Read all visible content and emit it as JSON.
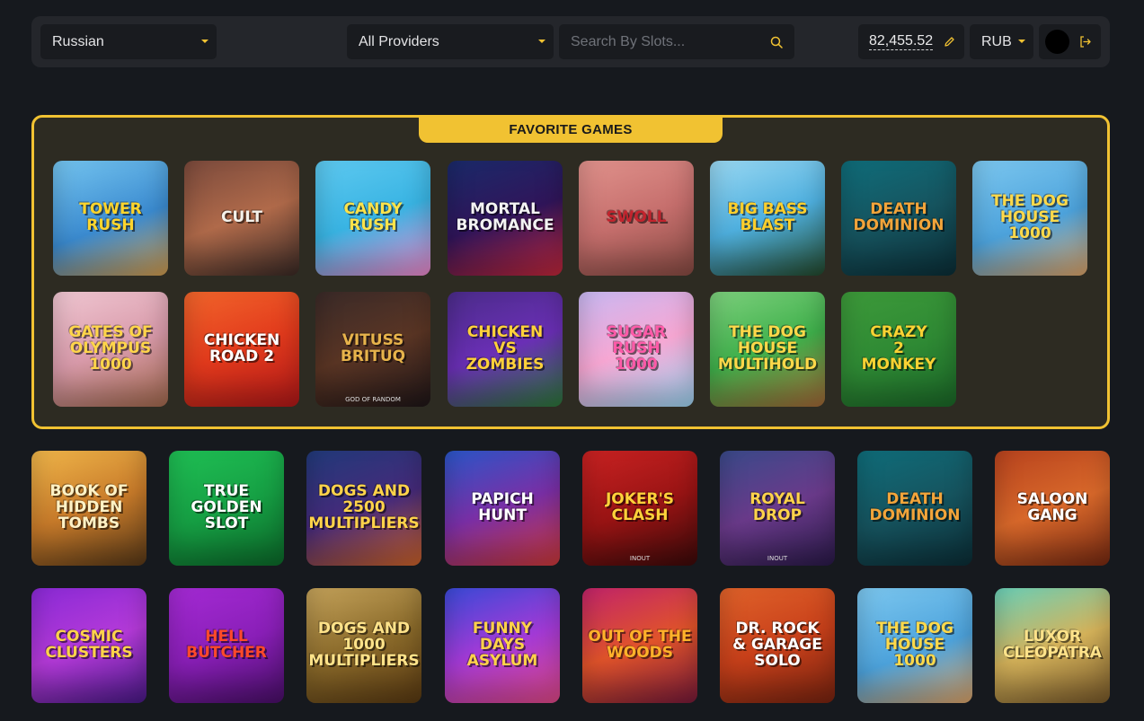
{
  "header": {
    "language": "Russian",
    "provider": "All Providers",
    "search_placeholder": "Search By Slots...",
    "balance": "82,455.52",
    "currency": "RUB"
  },
  "favorites": {
    "title": "FAVORITE GAMES",
    "games": [
      {
        "name": "TOWER\nRUSH",
        "bg": "linear-gradient(160deg,#74c4ef,#3b8bd0 55%,#d8a04e)",
        "color": "#ffd52c"
      },
      {
        "name": "CULT",
        "bg": "linear-gradient(160deg,#7b4a3c,#b06a4a 50%,#3a2a26)",
        "color": "#f4f1ea"
      },
      {
        "name": "CANDY\nRUSH",
        "bg": "linear-gradient(160deg,#5ec9f0,#39b4e3 50%,#f58bd0)",
        "color": "#ffe34a"
      },
      {
        "name": "MORTAL\nBROMANCE",
        "bg": "linear-gradient(160deg,#1a2a6a,#30155a 50%,#c7283c)",
        "color": "#f3f3f3"
      },
      {
        "name": "SWOLL",
        "bg": "linear-gradient(160deg,#e0928c,#c66f6d 50%,#8a4c44)",
        "color": "#c3232d"
      },
      {
        "name": "BIG BASS\nBLAST",
        "bg": "linear-gradient(160deg,#9ad8f2,#4fb0df 50%,#234a2c)",
        "color": "#ffcf2b"
      },
      {
        "name": "DEATH\nDOMINION",
        "bg": "linear-gradient(160deg,#0f6d7a,#16545f 50%,#0b2f38)",
        "color": "#f2a43a"
      },
      {
        "name": "THE DOG HOUSE\n1000",
        "bg": "linear-gradient(160deg,#7cc7ef,#4da3dc 55%,#e3a86a)",
        "color": "#ffd94a"
      },
      {
        "name": "GATES OF\nOLYMPUS\n1000",
        "bg": "linear-gradient(160deg,#f0c7d2,#d99bab 50%,#a66b4f)",
        "color": "#ffd54a"
      },
      {
        "name": "CHICKEN\nROAD 2",
        "bg": "linear-gradient(160deg,#f1652b,#e23a1c 50%,#b51919)",
        "color": "#ffffff"
      },
      {
        "name": "VITUSS BRITUQ",
        "sub": "GOD of RANDOM",
        "bg": "linear-gradient(160deg,#3a2a28,#5a3524 50%,#1f1618)",
        "color": "#e7b34b"
      },
      {
        "name": "CHICKEN\nVS\nZOMBIES",
        "bg": "linear-gradient(160deg,#4b2c8a,#6a2fb5 50%,#2d7a3a)",
        "color": "#ffd13a"
      },
      {
        "name": "SUGAR\nRUSH\n1000",
        "bg": "linear-gradient(160deg,#c8b8f2,#f7a7d3 50%,#9fd9f7)",
        "color": "#ff5aa8"
      },
      {
        "name": "THE DOG\nHOUSE MULTIHOLD",
        "bg": "linear-gradient(160deg,#7dd07d,#3fb04b 50%,#a76a38)",
        "color": "#ffd84a"
      },
      {
        "name": "CRAZY\n2\nMONKEY",
        "bg": "linear-gradient(160deg,#3d9a3a,#2f8a34 50%,#1c6a29)",
        "color": "#f9d233"
      }
    ]
  },
  "games": [
    {
      "name": "BOOK OF\nHIDDEN TOMBS",
      "bg": "linear-gradient(160deg,#f0b64a,#c87b2a 50%,#5a3a18)",
      "color": "#fff2c6"
    },
    {
      "name": "TRUE\nGOLDEN\nSLOT",
      "bg": "linear-gradient(160deg,#1fbf54,#16a044 50%,#0c6c2b)",
      "color": "#ffffff"
    },
    {
      "name": "DOGS AND 2500\nMULTIPLIERS",
      "bg": "linear-gradient(160deg,#213a7a,#452a7a 50%,#d0642a)",
      "color": "#ffd34a"
    },
    {
      "name": "PAPICH\nHUNT",
      "bg": "linear-gradient(160deg,#2a56c8,#7a2fa6 50%,#d23a3a)",
      "color": "#ffffff"
    },
    {
      "name": "JOKER'S\nCLASH",
      "sub": "INOUT",
      "bg": "linear-gradient(160deg,#c92222,#9a1414 50%,#3c0a0a)",
      "color": "#ffd23a"
    },
    {
      "name": "ROYAL\nDROP",
      "sub": "INOUT",
      "bg": "linear-gradient(160deg,#3a4a8a,#6a3a8a 50%,#2a1a4a)",
      "color": "#ffd34a"
    },
    {
      "name": "DEATH\nDOMINION",
      "bg": "linear-gradient(160deg,#0f6d7a,#16545f 50%,#0b2f38)",
      "color": "#f2a43a"
    },
    {
      "name": "SALOON\nGANG",
      "bg": "linear-gradient(160deg,#b8431e,#d8682a 50%,#7a2a12)",
      "color": "#ffffff"
    },
    {
      "name": "COSMIC\nCLUSTERS",
      "bg": "linear-gradient(160deg,#8a2ad6,#b43ad8 50%,#4a1a8a)",
      "color": "#ffd34a"
    },
    {
      "name": "HELL\nBUTCHER",
      "bg": "linear-gradient(160deg,#a42ad4,#8a1fb8 50%,#4a0f6a)",
      "color": "#ff4a2a"
    },
    {
      "name": "DOGS AND 1000\nMULTIPLIERS",
      "bg": "linear-gradient(160deg,#c4a25a,#8a6a2a 50%,#5a3a12)",
      "color": "#ffe38a"
    },
    {
      "name": "FUNNY DAYS\nASYLUM",
      "bg": "linear-gradient(160deg,#3a4ad8,#a33ad6 50%,#e64a8a)",
      "color": "#ffd24a"
    },
    {
      "name": "OUT OF THE\nWOODS",
      "bg": "linear-gradient(160deg,#c2246a,#e0532a 50%,#7a1a3a)",
      "color": "#ffb22a"
    },
    {
      "name": "DR. ROCK\n& GARAGE\nSOLO",
      "bg": "linear-gradient(160deg,#e0622a,#c8401a 50%,#7a2410)",
      "color": "#ffffff"
    },
    {
      "name": "THE DOG HOUSE\n1000",
      "bg": "linear-gradient(160deg,#7cc7ef,#4da3dc 55%,#e3a86a)",
      "color": "#ffd94a"
    },
    {
      "name": "LUXOR\nCLEOPATRA",
      "bg": "linear-gradient(160deg,#6ad0b8,#d4b25a 50%,#7a5a2a)",
      "color": "#ffe38a"
    }
  ]
}
